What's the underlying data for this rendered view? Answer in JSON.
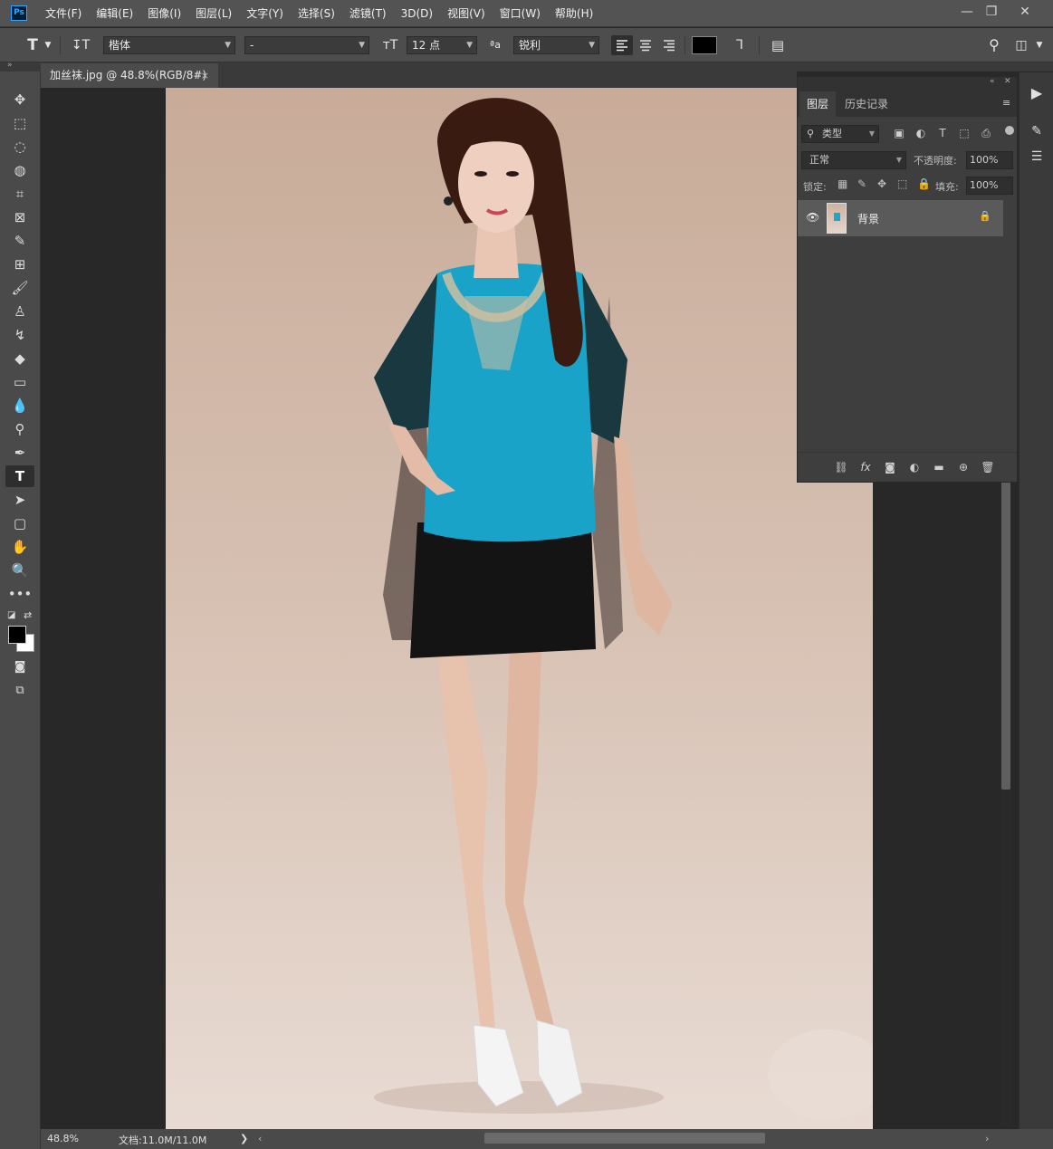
{
  "app": {
    "logo_text": "Ps",
    "menu": [
      "文件(F)",
      "编辑(E)",
      "图像(I)",
      "图层(L)",
      "文字(Y)",
      "选择(S)",
      "滤镜(T)",
      "3D(D)",
      "视图(V)",
      "窗口(W)",
      "帮助(H)"
    ],
    "window_buttons": {
      "minimize": "—",
      "restore": "❐",
      "close": "✕"
    }
  },
  "options_bar": {
    "font_family": "楷体",
    "font_style": "-",
    "font_size": "12 点",
    "antialias": "锐利",
    "text_color": "#000000"
  },
  "document": {
    "tab_title": "加丝袜.jpg @ 48.8%(RGB/8#)",
    "tab_close": "×"
  },
  "status": {
    "zoom": "48.8%",
    "doc_size": "文档:11.0M/11.0M",
    "arrow": "❯"
  },
  "layers_panel": {
    "tabs": [
      "图层",
      "历史记录"
    ],
    "filter_placeholder": "类型",
    "blend_mode": "正常",
    "opacity_label": "不透明度:",
    "opacity_value": "100%",
    "lock_label": "锁定:",
    "fill_label": "填充:",
    "fill_value": "100%",
    "layers": [
      {
        "name": "背景",
        "visible": true,
        "locked": true
      }
    ]
  }
}
